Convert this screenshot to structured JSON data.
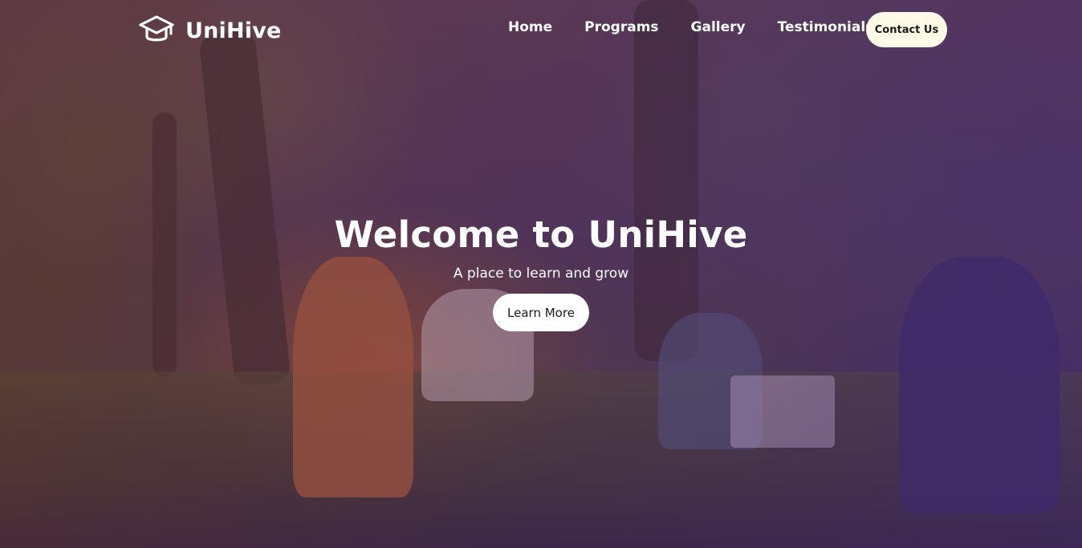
{
  "brand": {
    "name": "UniHive",
    "icon": "graduation-cap-icon"
  },
  "nav": {
    "links": [
      {
        "label": "Home"
      },
      {
        "label": "Programs"
      },
      {
        "label": "Gallery"
      },
      {
        "label": "Testimonials"
      }
    ],
    "contact_label": "Contact Us"
  },
  "hero": {
    "title": "Welcome to UniHive",
    "subtitle": "A place to learn and grow",
    "cta_label": "Learn More",
    "background": "photo-students-studying-on-grass-purple-overlay"
  },
  "colors": {
    "overlay": "#4b2d78",
    "contact_button_bg": "#fefae8",
    "cta_button_bg": "#ffffff",
    "text": "#ffffff"
  }
}
